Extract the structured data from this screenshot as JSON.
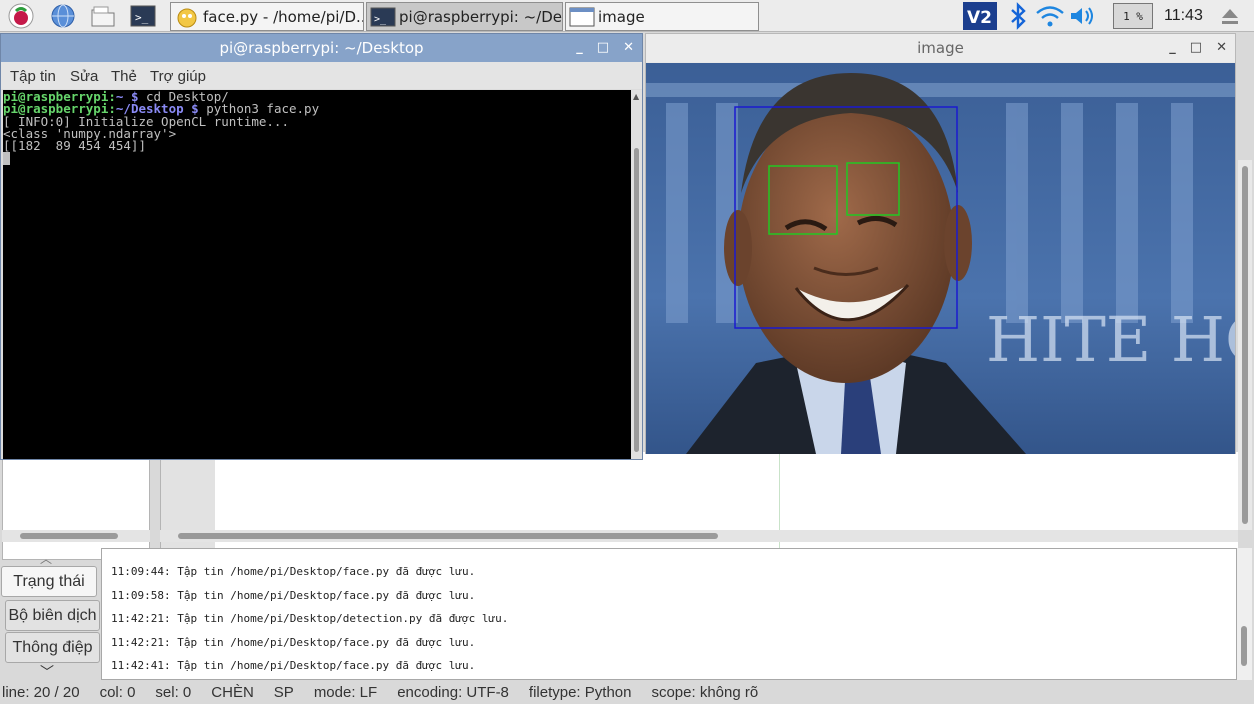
{
  "taskbar": {
    "tasks": [
      {
        "label": "face.py - /home/pi/D..."
      },
      {
        "label": "pi@raspberrypi: ~/De..."
      },
      {
        "label": "image"
      }
    ],
    "battery_percent": "1 %",
    "clock": "11:43"
  },
  "terminal": {
    "title": "pi@raspberrypi: ~/Desktop",
    "menu": [
      "Tập tin",
      "Sửa",
      "Thẻ",
      "Trợ giúp"
    ],
    "lines": [
      {
        "user": "pi@raspberrypi:",
        "path": "~ $",
        "cmd": " cd Desktop/"
      },
      {
        "user": "pi@raspberrypi:",
        "path": "~/Desktop $",
        "cmd": " python3 face.py"
      }
    ],
    "output": [
      "[ INFO:0] Initialize OpenCL runtime...",
      "<class 'numpy.ndarray'>",
      "[[182  89 454 454]]"
    ]
  },
  "image_window": {
    "title": "image",
    "colors": {
      "face_box": "#1a1ad0",
      "eye_box": "#22c822"
    }
  },
  "geany": {
    "side_tabs": [
      "Trạng thái",
      "Bộ biên dịch",
      "Thông điệp"
    ],
    "messages": [
      "11:09:44: Tập tin /home/pi/Desktop/face.py đã được lưu.",
      "11:09:58: Tập tin /home/pi/Desktop/face.py đã được lưu.",
      "11:42:21: Tập tin /home/pi/Desktop/detection.py đã được lưu.",
      "11:42:21: Tập tin /home/pi/Desktop/face.py đã được lưu.",
      "11:42:41: Tập tin /home/pi/Desktop/face.py đã được lưu."
    ],
    "status": {
      "line": "line: 20 / 20",
      "col": "col: 0",
      "sel": "sel: 0",
      "mode_ins": "CHÈN",
      "indent": "SP",
      "eol": "mode: LF",
      "encoding": "encoding: UTF-8",
      "filetype": "filetype: Python",
      "scope": "scope: không rõ"
    }
  }
}
